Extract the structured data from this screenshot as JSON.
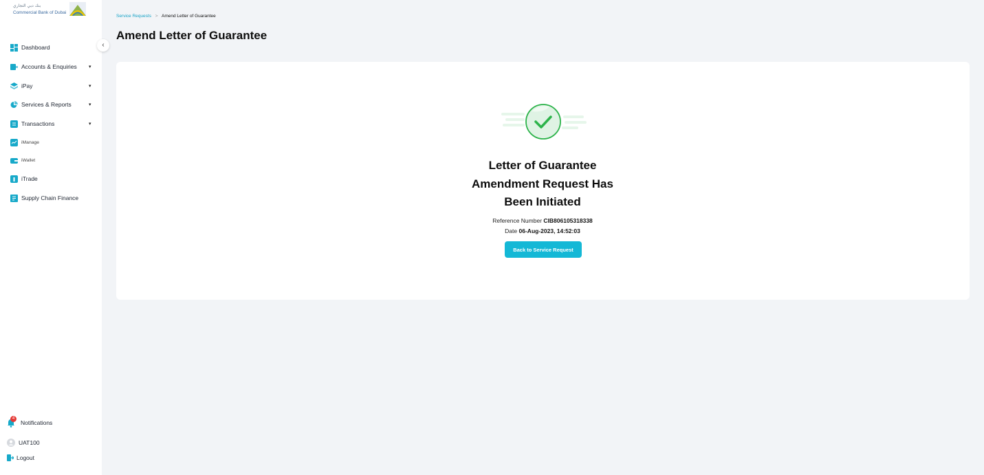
{
  "brand": {
    "arabic_name": "بنك دبي التجاري",
    "english_name": "Commercial Bank of Dubai"
  },
  "sidebar": {
    "collapse_icon": "‹",
    "items": [
      {
        "label": "Dashboard",
        "icon": "dashboard-icon",
        "caret": false
      },
      {
        "label": "Accounts & Enquiries",
        "icon": "accounts-icon",
        "caret": true
      },
      {
        "label": "iPay",
        "icon": "ipay-icon",
        "caret": true
      },
      {
        "label": "Services & Reports",
        "icon": "services-icon",
        "caret": true
      },
      {
        "label": "Transactions",
        "icon": "transactions-icon",
        "caret": true
      },
      {
        "label": "iManage",
        "icon": "imanage-icon",
        "caret": false
      },
      {
        "label": "iWallet",
        "icon": "iwallet-icon",
        "caret": false
      },
      {
        "label": "iTrade",
        "icon": "itrade-icon",
        "caret": false
      },
      {
        "label": "Supply Chain Finance",
        "icon": "supply-chain-icon",
        "caret": false
      }
    ],
    "caret_glyph": "▾",
    "notifications": {
      "label": "Notifications",
      "badge": "4"
    },
    "user": {
      "label": "UAT100"
    },
    "logout": {
      "label": "Logout"
    }
  },
  "breadcrumb": {
    "parent": "Service Requests",
    "separator": ">",
    "current": "Amend Letter of Guarantee"
  },
  "page_title": "Amend Letter of Guarantee",
  "result": {
    "title_line1": "Letter of Guarantee",
    "title_line2": "Amendment Request Has",
    "title_line3": "Been Initiated",
    "reference_label": "Reference Number",
    "reference_value": "CIB806105318338",
    "date_label": "Date",
    "date_value": "06-Aug-2023, 14:52:03",
    "back_button": "Back to Service Request"
  },
  "colors": {
    "accent": "#14b8d6",
    "icon": "#17a9c9",
    "success": "#2cb34a",
    "background": "#f2f4f7",
    "badge": "#e53935"
  }
}
